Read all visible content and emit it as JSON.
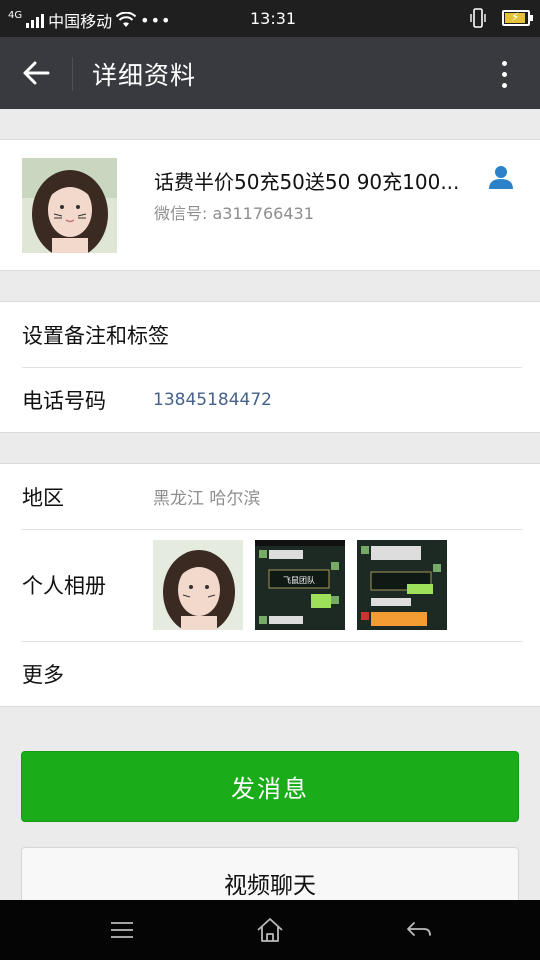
{
  "status_bar": {
    "network": "4G",
    "carrier": "中国移动",
    "more": "•••",
    "time": "13:31"
  },
  "header": {
    "title": "详细资料"
  },
  "profile": {
    "nickname": "话费半价50充50送50 90充100...",
    "wechat_id": "微信号: a311766431"
  },
  "info": {
    "remark_label": "设置备注和标签",
    "phone_label": "电话号码",
    "phone_value": "13845184472"
  },
  "details": {
    "region_label": "地区",
    "region_value": "黑龙江  哈尔滨",
    "album_label": "个人相册",
    "more_label": "更多",
    "album_thumbs": [
      {
        "kind": "portrait"
      },
      {
        "kind": "chat-screenshot",
        "caption": "飞鼠团队"
      },
      {
        "kind": "chat-screenshot",
        "caption": ""
      }
    ]
  },
  "actions": {
    "send_message": "发消息",
    "video_chat": "视频聊天"
  },
  "colors": {
    "header_bg": "#393a3f",
    "primary_green": "#1aad19",
    "link_blue": "#45628c",
    "contact_icon": "#2c82c9"
  }
}
